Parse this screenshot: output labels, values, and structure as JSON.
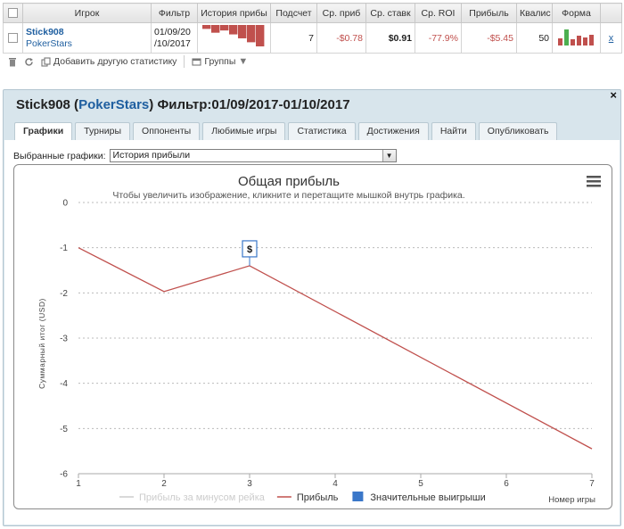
{
  "table": {
    "headers": [
      "",
      "Игрок",
      "Фильтр",
      "История прибы",
      "Подсчет",
      "Ср. приб",
      "Ср. ставк",
      "Ср. ROI",
      "Прибыль",
      "Квалис",
      "Форма",
      ""
    ],
    "row": {
      "player": "Stick908",
      "site": "PokerStars",
      "filter_line1": "01/09/20",
      "filter_line2": "/10/2017",
      "count": "7",
      "avg_profit": "-$0.78",
      "avg_stake": "$0.91",
      "avg_roi": "-77.9%",
      "profit": "-$5.45",
      "quality": "50",
      "remove": "x"
    },
    "history_sparkline": [
      -1.0,
      -1.97,
      -1.4,
      -2.4,
      -3.4,
      -4.4,
      -5.45
    ],
    "form_bars": [
      {
        "value": 0.4,
        "color": "#c0504d"
      },
      {
        "value": 0.9,
        "color": "#4caf50"
      },
      {
        "value": 0.35,
        "color": "#c0504d"
      },
      {
        "value": 0.55,
        "color": "#c0504d"
      },
      {
        "value": 0.45,
        "color": "#c0504d"
      },
      {
        "value": 0.6,
        "color": "#c0504d"
      }
    ]
  },
  "toolbar": {
    "delete_icon": "trash-icon",
    "refresh_icon": "refresh-icon",
    "add_stats_label": "Добавить другую статистику",
    "groups_label": "Группы"
  },
  "panel": {
    "player": "Stick908",
    "site": "PokerStars",
    "filter_label": "Фильтр:01/09/2017-01/10/2017",
    "close": "×",
    "tabs": [
      "Графики",
      "Турниры",
      "Оппоненты",
      "Любимые игры",
      "Статистика",
      "Достижения",
      "Найти",
      "Опубликовать"
    ],
    "select_label": "Выбранные графики:",
    "select_value": "История прибыли"
  },
  "chart_data": {
    "type": "line",
    "title": "Общая прибыль",
    "subtitle": "Чтобы увеличить изображение, кликните и перетащите мышкой внутрь графика.",
    "xlabel": "Номер игры",
    "ylabel": "Суммарный итог (USD)",
    "xlim": [
      1,
      7
    ],
    "ylim": [
      -6,
      0
    ],
    "x_ticks": [
      1,
      2,
      3,
      4,
      5,
      6,
      7
    ],
    "y_ticks": [
      0,
      -1,
      -2,
      -3,
      -4,
      -5,
      -6
    ],
    "series": [
      {
        "name": "Прибыль",
        "color": "#c0504d",
        "x": [
          1,
          2,
          3,
          7
        ],
        "y": [
          -1.0,
          -1.97,
          -1.4,
          -5.45
        ]
      }
    ],
    "legend": [
      {
        "name": "Прибыль за минусом рейка",
        "color": "#cccccc",
        "kind": "line",
        "muted": true
      },
      {
        "name": "Прибыль",
        "color": "#c0504d",
        "kind": "line",
        "muted": false
      },
      {
        "name": "Значительные выигрыши",
        "color": "#3a77c9",
        "kind": "box",
        "muted": false
      }
    ],
    "flags": [
      {
        "x": 3,
        "y": -1.4,
        "label": "$"
      }
    ],
    "grid": true,
    "legend_position": "bottom"
  }
}
